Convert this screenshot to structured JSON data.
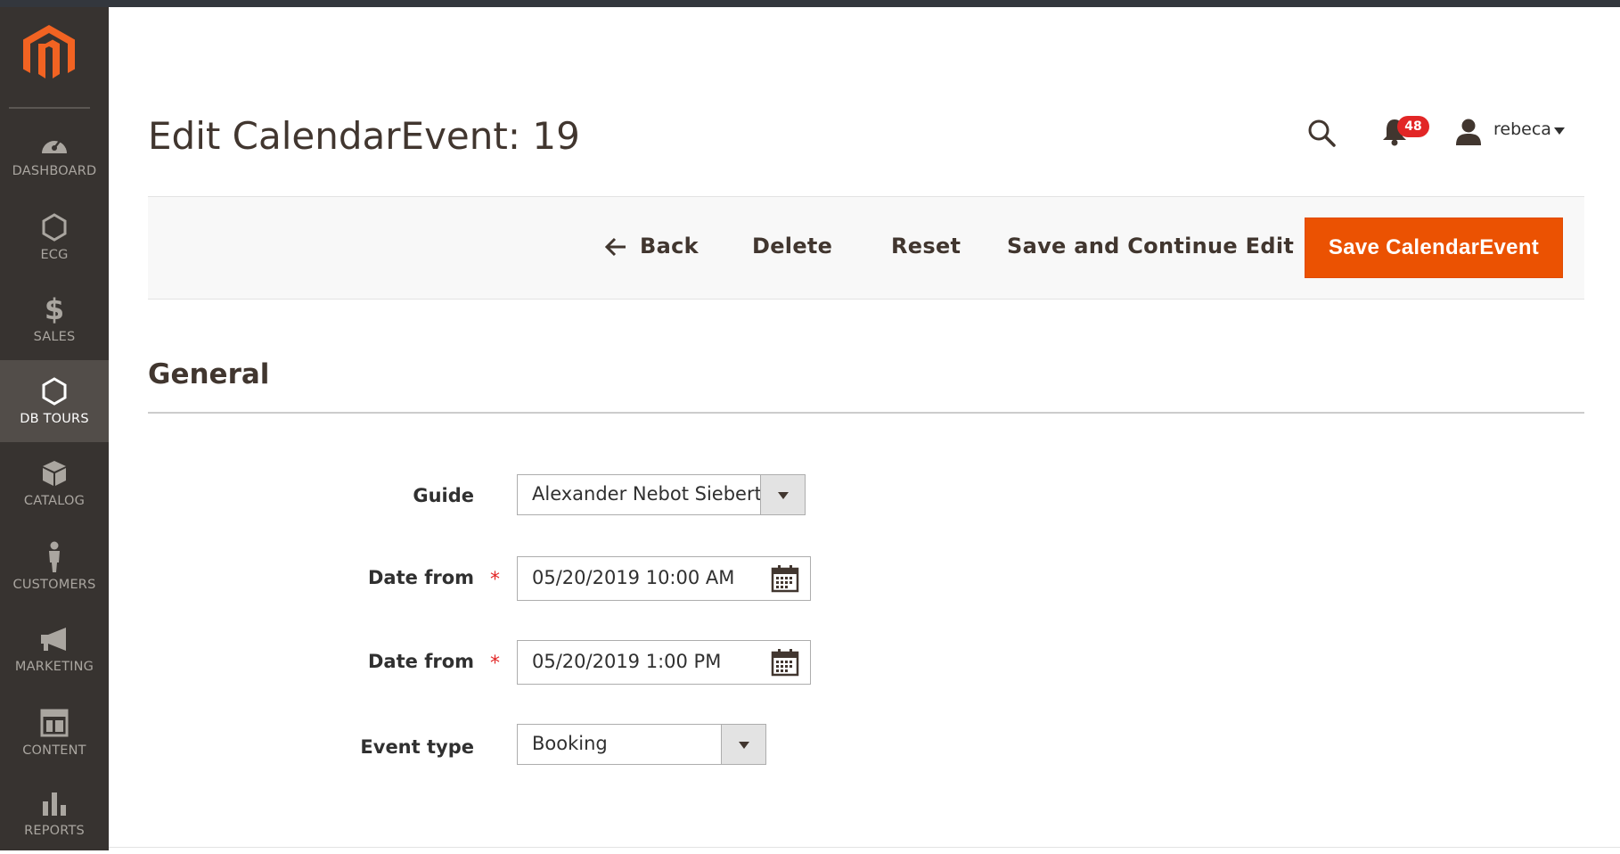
{
  "sidebar": {
    "logo": "magento-logo",
    "items": [
      {
        "label": "DASHBOARD",
        "icon": "dashboard-icon"
      },
      {
        "label": "ECG",
        "icon": "hexagon-icon"
      },
      {
        "label": "SALES",
        "icon": "dollar-icon"
      },
      {
        "label": "DB TOURS",
        "icon": "hexagon-icon",
        "active": true
      },
      {
        "label": "CATALOG",
        "icon": "box-icon"
      },
      {
        "label": "CUSTOMERS",
        "icon": "person-icon"
      },
      {
        "label": "MARKETING",
        "icon": "megaphone-icon"
      },
      {
        "label": "CONTENT",
        "icon": "layout-icon"
      },
      {
        "label": "REPORTS",
        "icon": "bar-chart-icon"
      }
    ]
  },
  "header": {
    "title": "Edit CalendarEvent: 19",
    "notifications_count": "48",
    "user_name": "rebeca"
  },
  "actions": {
    "back": "Back",
    "delete": "Delete",
    "reset": "Reset",
    "save_continue": "Save and Continue Edit",
    "save": "Save CalendarEvent"
  },
  "section": {
    "title": "General"
  },
  "form": {
    "guide": {
      "label": "Guide",
      "value": "Alexander Nebot Siebert"
    },
    "date_from_1": {
      "label": "Date from",
      "value": "05/20/2019 10:00 AM",
      "required": "*"
    },
    "date_from_2": {
      "label": "Date from",
      "value": "05/20/2019 1:00 PM",
      "required": "*"
    },
    "event_type": {
      "label": "Event type",
      "value": "Booking"
    }
  },
  "colors": {
    "sidebar_bg": "#373330",
    "sidebar_active": "#524d49",
    "primary": "#eb5202",
    "badge": "#e22626",
    "logo": "#f26322"
  }
}
